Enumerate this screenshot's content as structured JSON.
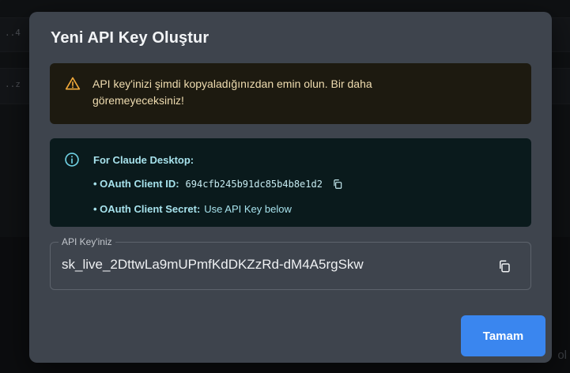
{
  "background": {
    "row1_cell": "..4",
    "row2_cell": "..z",
    "corner_text": "ol"
  },
  "modal": {
    "title": "Yeni API Key Oluştur",
    "warning": {
      "icon": "warning-triangle-icon",
      "text": "API key'inizi şimdi kopyaladığınızdan emin olun. Bir daha göremeyeceksiniz!"
    },
    "info": {
      "icon": "info-circle-icon",
      "heading": "For Claude Desktop:",
      "client_id_label": "• OAuth Client ID:",
      "client_id_value": "694cfb245b91dc85b4b8e1d2",
      "client_secret_label": "• OAuth Client Secret:",
      "client_secret_value": "Use API Key below"
    },
    "api_key_field": {
      "label": "API Key'iniz",
      "value": "sk_live_2DttwLa9mUPmfKdDKZzRd-dM4A5rgSkw"
    },
    "ok_label": "Tamam"
  },
  "colors": {
    "modal_bg": "#3e444d",
    "warning_bg": "#1d1a10",
    "warning_text": "#efdcb0",
    "warning_icon": "#f0a93b",
    "info_bg": "#0a1a1c",
    "info_text": "#a7e2ec",
    "primary_button": "#3a86ef"
  }
}
